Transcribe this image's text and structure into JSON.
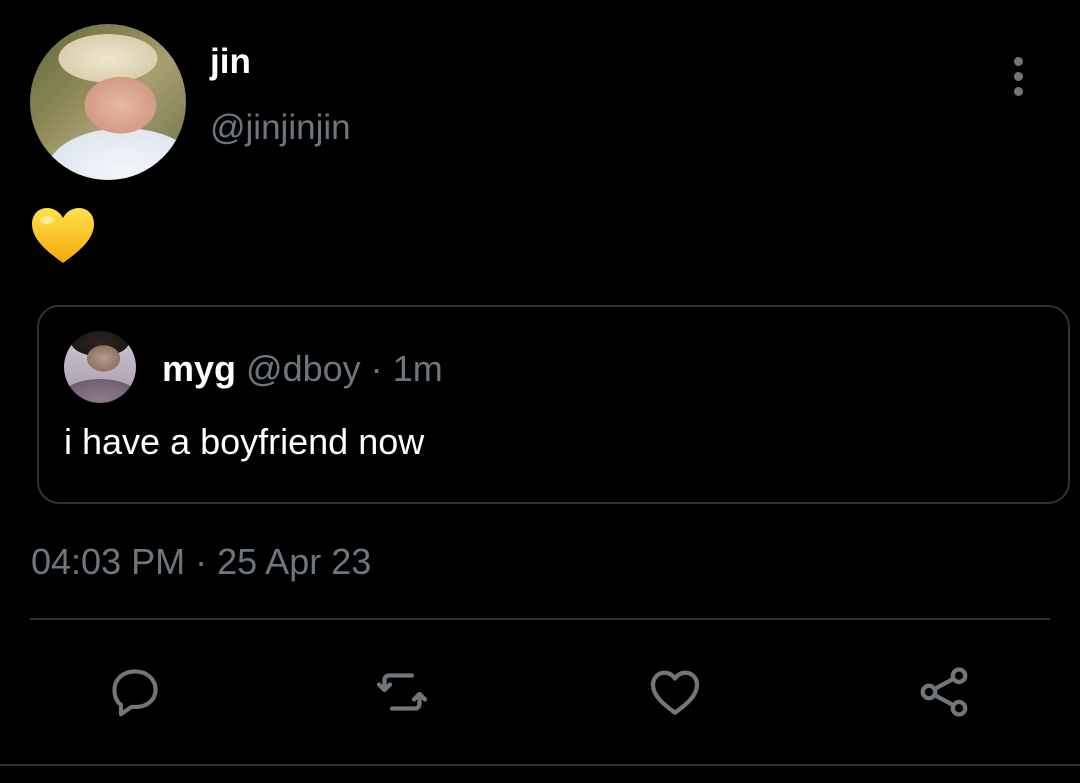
{
  "tweet": {
    "author": {
      "display_name": "jin",
      "handle": "@jinjinjin"
    },
    "text": "💛",
    "quoted": {
      "display_name": "myg",
      "handle": "@dboy",
      "separator": "·",
      "age": "1m",
      "text": "i have a boyfriend now"
    },
    "time": "04:03 PM",
    "date_separator": "·",
    "date": "25 Apr 23"
  },
  "icons": {
    "more": "more-vertical-icon",
    "reply": "reply-icon",
    "retweet": "retweet-icon",
    "like": "heart-icon",
    "share": "share-icon"
  },
  "colors": {
    "background": "#000000",
    "text_primary": "#ffffff",
    "text_secondary": "#6e767d",
    "border": "#2f3336",
    "icon": "#71767b"
  }
}
